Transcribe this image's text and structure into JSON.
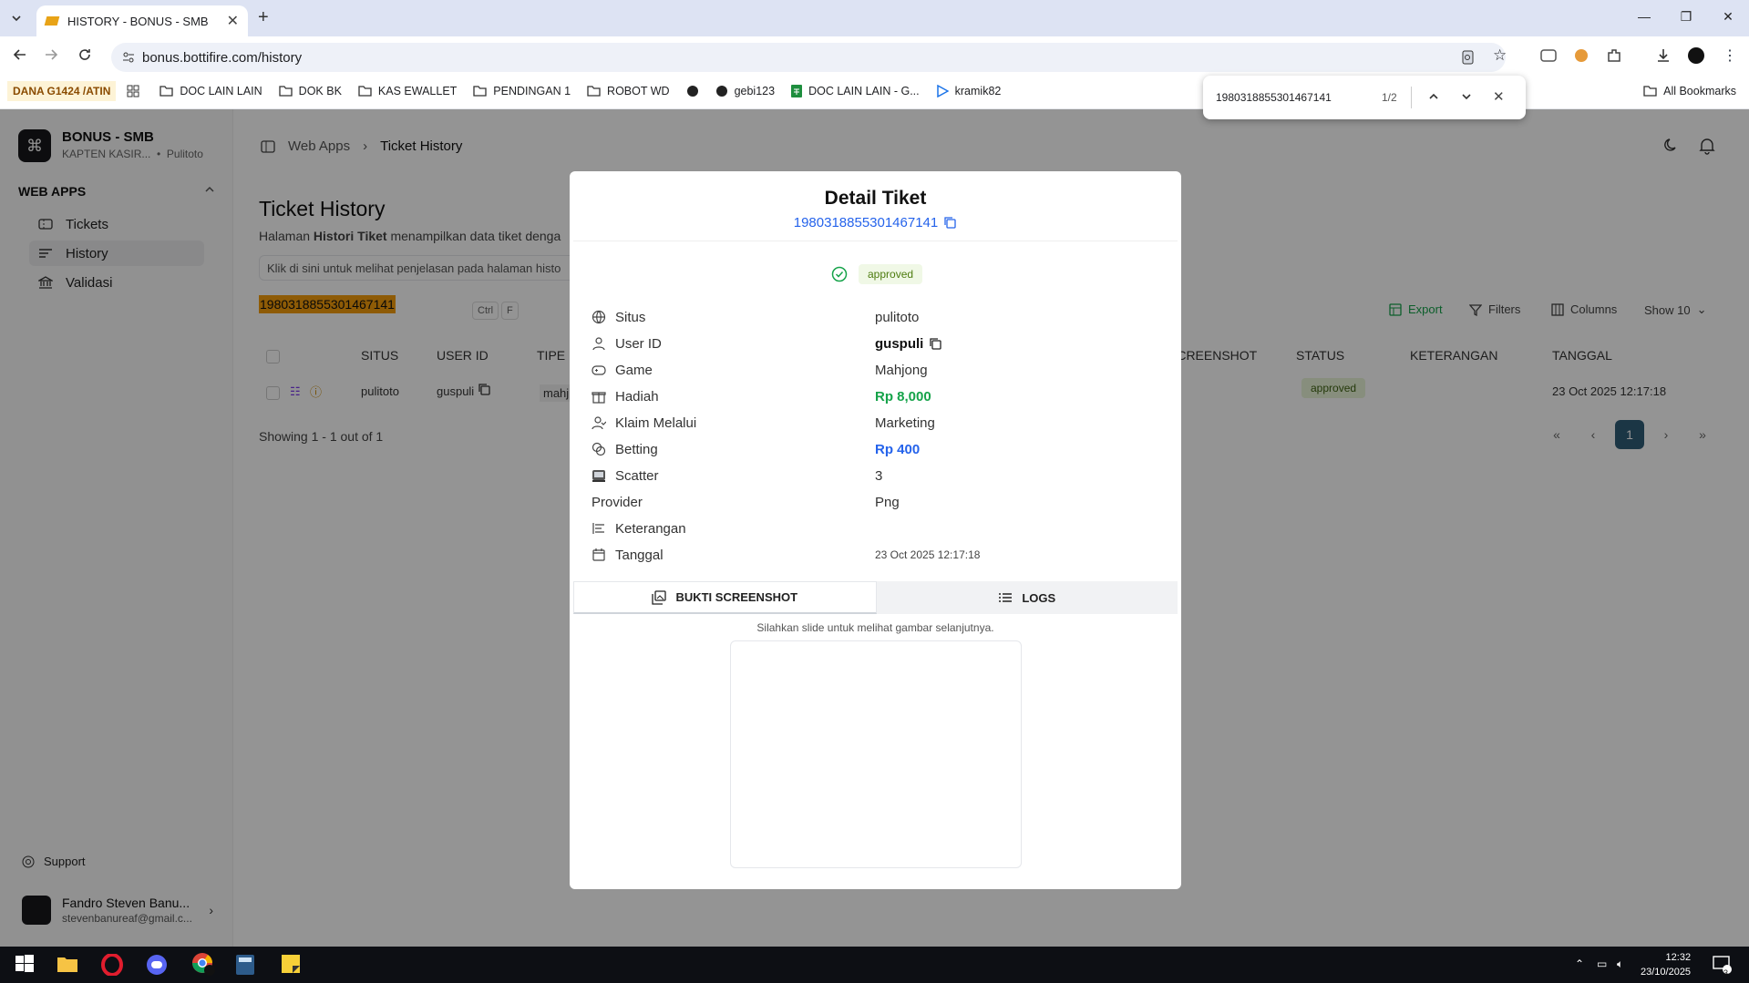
{
  "browser": {
    "tab_title": "HISTORY - BONUS - SMB",
    "url": "bonus.bottifire.com/history",
    "bookmarks": [
      "DOC LAIN LAIN",
      "DOK BK",
      "KAS EWALLET",
      "PENDINGAN 1",
      "ROBOT WD",
      "gebi123",
      "DOC LAIN LAIN - G...",
      "kramik82"
    ],
    "bookmark_tag": "DANA G1424 /ATIN",
    "all_bookmarks": "All Bookmarks",
    "find": {
      "query": "1980318855301467141",
      "count": "1/2"
    }
  },
  "sidebar": {
    "brand_title": "BONUS - SMB",
    "brand_sub1": "KAPTEN KASIR...",
    "brand_sub2": "Pulitoto",
    "group": "WEB APPS",
    "items": [
      {
        "label": "Tickets"
      },
      {
        "label": "History"
      },
      {
        "label": "Validasi"
      }
    ],
    "support": "Support",
    "user_name": "Fandro Steven Banu...",
    "user_email": "stevenbanureaf@gmail.c..."
  },
  "main": {
    "breadcrumb_root": "Web Apps",
    "breadcrumb_current": "Ticket History",
    "title": "Ticket History",
    "desc_pre": "Halaman ",
    "desc_bold": "Histori Tiket",
    "desc_post": " menampilkan data tiket denga",
    "info": "Klik di sini untuk melihat penjelasan pada halaman histo",
    "search_value": "1980318855301467141",
    "kbd1": "Ctrl",
    "kbd2": "F",
    "export": "Export",
    "filters": "Filters",
    "columns": "Columns",
    "show": "Show 10",
    "headers": [
      "SITUS",
      "USER ID",
      "TIPE",
      "SCREENSHOT",
      "STATUS",
      "KETERANGAN",
      "TANGGAL"
    ],
    "row": {
      "situs": "pulitoto",
      "user_id": "guspuli",
      "tipe": "mahj",
      "status": "approved",
      "tanggal": "23 Oct 2025 12:17:18"
    },
    "showing": "Showing 1 - 1 out of 1",
    "page": "1"
  },
  "modal": {
    "title": "Detail Tiket",
    "ticket_id": "1980318855301467141",
    "status": "approved",
    "fields": [
      {
        "label": "Situs",
        "value": "pulitoto"
      },
      {
        "label": "User ID",
        "value": "guspuli"
      },
      {
        "label": "Game",
        "value": "Mahjong"
      },
      {
        "label": "Hadiah",
        "value": "Rp 8,000"
      },
      {
        "label": "Klaim Melalui",
        "value": "Marketing"
      },
      {
        "label": "Betting",
        "value": "Rp 400"
      },
      {
        "label": "Scatter",
        "value": "3"
      },
      {
        "label": "Provider",
        "value": "Png"
      },
      {
        "label": "Keterangan",
        "value": ""
      },
      {
        "label": "Tanggal",
        "value": "23 Oct 2025 12:17:18"
      }
    ],
    "tab_screenshot": "BUKTI SCREENSHOT",
    "tab_logs": "LOGS",
    "hint": "Silahkan slide untuk melihat gambar selanjutnya."
  },
  "taskbar": {
    "time": "12:32",
    "date": "23/10/2025",
    "notif": "3"
  },
  "colors": {
    "green": "#16a34a",
    "blue": "#2563eb",
    "highlight": "#f59e0b",
    "page_active": "#2f5d78"
  }
}
